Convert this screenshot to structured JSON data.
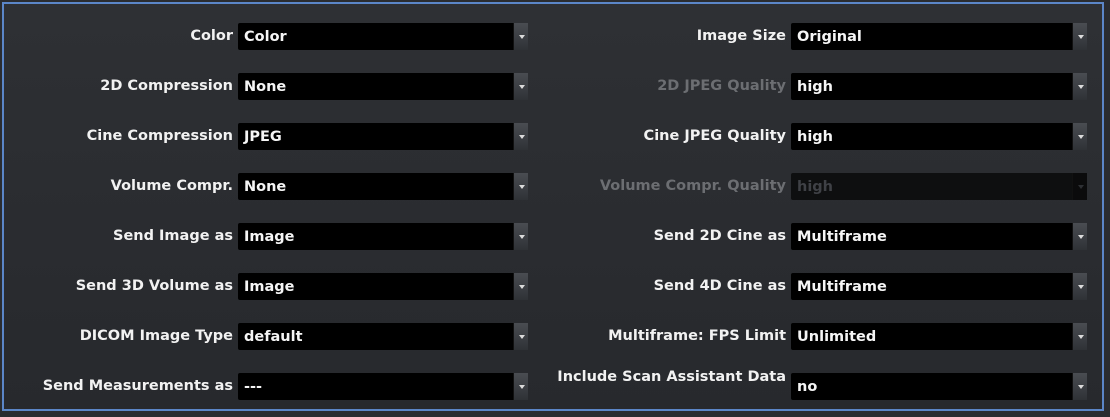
{
  "left": [
    {
      "label": "Color",
      "value": "Color",
      "disabled": false
    },
    {
      "label": "2D Compression",
      "value": "None",
      "disabled": false
    },
    {
      "label": "Cine Compression",
      "value": "JPEG",
      "disabled": false
    },
    {
      "label": "Volume Compr.",
      "value": "None",
      "disabled": false
    },
    {
      "label": "Send Image as",
      "value": "Image",
      "disabled": false
    },
    {
      "label": "Send 3D Volume as",
      "value": "Image",
      "disabled": false
    },
    {
      "label": "DICOM Image Type",
      "value": "default",
      "disabled": false
    },
    {
      "label": "Send Measurements as",
      "value": "---",
      "disabled": false
    }
  ],
  "right": [
    {
      "label": "Image Size",
      "value": "Original",
      "disabled": false
    },
    {
      "label": "2D JPEG Quality",
      "value": "high",
      "disabled": true,
      "value_enabled": true
    },
    {
      "label": "Cine JPEG Quality",
      "value": "high",
      "disabled": false
    },
    {
      "label": "Volume Compr. Quality",
      "value": "high",
      "disabled": true
    },
    {
      "label": "Send 2D Cine as",
      "value": "Multiframe",
      "disabled": false
    },
    {
      "label": "Send 4D Cine as",
      "value": "Multiframe",
      "disabled": false
    },
    {
      "label": "Multiframe: FPS Limit",
      "value": "Unlimited",
      "disabled": false
    },
    {
      "label": "Include Scan Assistant Data",
      "value": "no",
      "disabled": false
    }
  ],
  "icons": {
    "dropdown": "chevron-down-icon"
  }
}
